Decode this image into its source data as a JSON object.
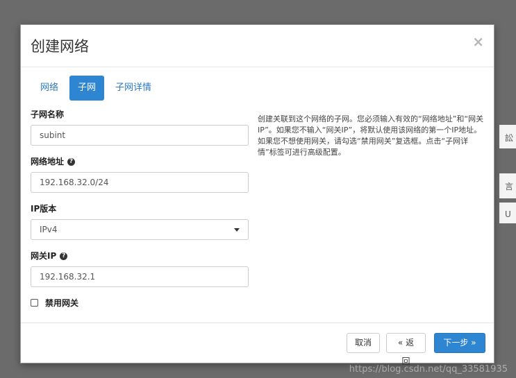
{
  "background": {
    "peek_a": "訟",
    "peek_b": "言",
    "peek_c": "U"
  },
  "modal": {
    "title": "创建网络",
    "close_symbol": "×",
    "tabs": [
      {
        "label": "网络",
        "active": false
      },
      {
        "label": "子网",
        "active": true
      },
      {
        "label": "子网详情",
        "active": false
      }
    ],
    "form": {
      "subnet_name_label": "子网名称",
      "subnet_name_value": "subint",
      "network_address_label": "网络地址",
      "network_address_value": "192.168.32.0/24",
      "ip_version_label": "IP版本",
      "ip_version_value": "IPv4",
      "gateway_ip_label": "网关IP",
      "gateway_ip_value": "192.168.32.1",
      "disable_gateway_label": "禁用网关",
      "disable_gateway_checked": false
    },
    "help_text": "创建关联到这个网络的子网。您必须输入有效的“网络地址”和“网关IP”。如果您不输入“网关IP”，将默认使用该网络的第一个IP地址。如果您不想使用网关，请勾选“禁用网关”复选框。点击“子网详情”标签可进行高级配置。",
    "footer": {
      "cancel_label": "取消",
      "back_label": "« 返回",
      "next_label": "下一步 »"
    }
  },
  "watermark": "https://blog.csdn.net/qq_33581935",
  "colors": {
    "accent": "#2e86d2",
    "overlay": "#6b6b6b"
  }
}
